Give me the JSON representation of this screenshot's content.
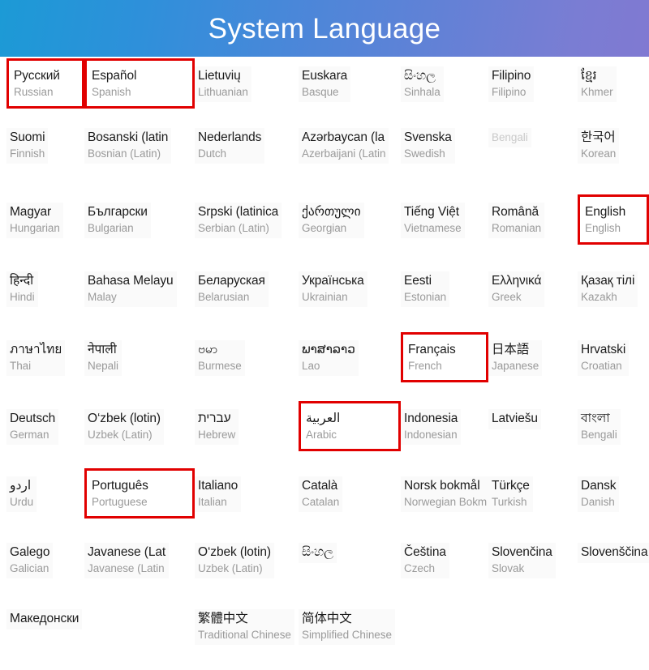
{
  "header": {
    "title": "System Language",
    "gradient_from": "#1C9AD6",
    "gradient_to": "#8079D2",
    "text_color": "#ffffff"
  },
  "highlight": {
    "color": "#e10000",
    "border_px": 3,
    "selected_languages": [
      "Russian",
      "Spanish",
      "English",
      "French",
      "Arabic",
      "Portuguese"
    ]
  },
  "grid": {
    "columns": 7,
    "rows": 9,
    "native_color": "#1b1b1b",
    "english_color": "#9a9a9a",
    "cell_background": "#fafafa"
  },
  "languages": [
    [
      {
        "native": "Русский",
        "english": "Russian",
        "highlighted": true,
        "native_faded": false,
        "english_faded": false
      },
      {
        "native": "Español",
        "english": "Spanish",
        "highlighted": true,
        "native_faded": false,
        "english_faded": false
      },
      {
        "native": "Lietuvių",
        "english": "Lithuanian",
        "highlighted": false,
        "native_faded": false,
        "english_faded": false
      },
      {
        "native": "Euskara",
        "english": "Basque",
        "highlighted": false,
        "native_faded": false,
        "english_faded": false
      },
      {
        "native": "සිංහල",
        "english": "Sinhala",
        "highlighted": false,
        "native_faded": false,
        "english_faded": false
      },
      {
        "native": "Filipino",
        "english": "Filipino",
        "highlighted": false,
        "native_faded": false,
        "english_faded": false
      },
      {
        "native": "ខ្មែរ",
        "english": "Khmer",
        "highlighted": false,
        "native_faded": false,
        "english_faded": false
      }
    ],
    [
      {
        "native": "Suomi",
        "english": "Finnish",
        "highlighted": false,
        "native_faded": false,
        "english_faded": false
      },
      {
        "native": "Bosanski (latin",
        "english": "Bosnian (Latin)",
        "highlighted": false,
        "native_faded": false,
        "english_faded": false
      },
      {
        "native": "Nederlands",
        "english": "Dutch",
        "highlighted": false,
        "native_faded": false,
        "english_faded": false
      },
      {
        "native": "Azərbaycan (la",
        "english": "Azerbaijani (Latin",
        "highlighted": false,
        "native_faded": false,
        "english_faded": false
      },
      {
        "native": "Svenska",
        "english": "Swedish",
        "highlighted": false,
        "native_faded": false,
        "english_faded": false
      },
      {
        "native": "",
        "english": "Bengali",
        "highlighted": false,
        "native_faded": false,
        "english_faded": true
      },
      {
        "native": "한국어",
        "english": "Korean",
        "highlighted": false,
        "native_faded": false,
        "english_faded": false
      }
    ],
    [
      {
        "native": "Magyar",
        "english": "Hungarian",
        "highlighted": false,
        "native_faded": false,
        "english_faded": false
      },
      {
        "native": "Български",
        "english": "Bulgarian",
        "highlighted": false,
        "native_faded": false,
        "english_faded": false
      },
      {
        "native": "Srpski (latinica",
        "english": "Serbian (Latin)",
        "highlighted": false,
        "native_faded": false,
        "english_faded": false
      },
      {
        "native": "ქართული",
        "english": "Georgian",
        "highlighted": false,
        "native_faded": false,
        "english_faded": false
      },
      {
        "native": "Tiếng Việt",
        "english": "Vietnamese",
        "highlighted": false,
        "native_faded": false,
        "english_faded": false
      },
      {
        "native": "Română",
        "english": "Romanian",
        "highlighted": false,
        "native_faded": false,
        "english_faded": false
      },
      {
        "native": "English",
        "english": "English",
        "highlighted": true,
        "native_faded": false,
        "english_faded": false
      }
    ],
    [
      {
        "native": "हिन्दी",
        "english": "Hindi",
        "highlighted": false,
        "native_faded": false,
        "english_faded": false
      },
      {
        "native": "Bahasa Melayu",
        "english": "Malay",
        "highlighted": false,
        "native_faded": false,
        "english_faded": false
      },
      {
        "native": "Беларуская",
        "english": "Belarusian",
        "highlighted": false,
        "native_faded": false,
        "english_faded": false
      },
      {
        "native": "Українська",
        "english": "Ukrainian",
        "highlighted": false,
        "native_faded": false,
        "english_faded": false
      },
      {
        "native": "Eesti",
        "english": "Estonian",
        "highlighted": false,
        "native_faded": false,
        "english_faded": false
      },
      {
        "native": "Ελληνικά",
        "english": "Greek",
        "highlighted": false,
        "native_faded": false,
        "english_faded": false
      },
      {
        "native": "Қазақ тілі",
        "english": "Kazakh",
        "highlighted": false,
        "native_faded": false,
        "english_faded": false
      }
    ],
    [
      {
        "native": "ภาษาไทย",
        "english": "Thai",
        "highlighted": false,
        "native_faded": false,
        "english_faded": false
      },
      {
        "native": "नेपाली",
        "english": "Nepali",
        "highlighted": false,
        "native_faded": false,
        "english_faded": false
      },
      {
        "native": "ဗမာ",
        "english": "Burmese",
        "highlighted": false,
        "native_faded": false,
        "english_faded": false
      },
      {
        "native": "ພາສາລາວ",
        "english": "Lao",
        "highlighted": false,
        "native_faded": false,
        "english_faded": false
      },
      {
        "native": "Français",
        "english": "French",
        "highlighted": true,
        "native_faded": false,
        "english_faded": false
      },
      {
        "native": "日本語",
        "english": "Japanese",
        "highlighted": false,
        "native_faded": false,
        "english_faded": false
      },
      {
        "native": "Hrvatski",
        "english": "Croatian",
        "highlighted": false,
        "native_faded": false,
        "english_faded": false
      }
    ],
    [
      {
        "native": "Deutsch",
        "english": "German",
        "highlighted": false,
        "native_faded": false,
        "english_faded": false
      },
      {
        "native": "O‘zbek (lotin)",
        "english": "Uzbek (Latin)",
        "highlighted": false,
        "native_faded": false,
        "english_faded": false
      },
      {
        "native": "עברית",
        "english": "Hebrew",
        "highlighted": false,
        "native_faded": false,
        "english_faded": false
      },
      {
        "native": "العربية",
        "english": "Arabic",
        "highlighted": true,
        "native_faded": false,
        "english_faded": false
      },
      {
        "native": "Indonesia",
        "english": "Indonesian",
        "highlighted": false,
        "native_faded": false,
        "english_faded": false
      },
      {
        "native": "Latviešu",
        "english": "",
        "highlighted": false,
        "native_faded": false,
        "english_faded": false
      },
      {
        "native": "বাংলা",
        "english": "Bengali",
        "highlighted": false,
        "native_faded": false,
        "english_faded": false
      }
    ],
    [
      {
        "native": "اردو",
        "english": "Urdu",
        "highlighted": false,
        "native_faded": false,
        "english_faded": false
      },
      {
        "native": "Português",
        "english": "Portuguese",
        "highlighted": true,
        "native_faded": false,
        "english_faded": false
      },
      {
        "native": "Italiano",
        "english": "Italian",
        "highlighted": false,
        "native_faded": false,
        "english_faded": false
      },
      {
        "native": "Català",
        "english": "Catalan",
        "highlighted": false,
        "native_faded": false,
        "english_faded": false
      },
      {
        "native": "Norsk bokmål",
        "english": "Norwegian Bokm",
        "highlighted": false,
        "native_faded": false,
        "english_faded": false
      },
      {
        "native": "Türkçe",
        "english": "Turkish",
        "highlighted": false,
        "native_faded": false,
        "english_faded": false
      },
      {
        "native": "Dansk",
        "english": "Danish",
        "highlighted": false,
        "native_faded": false,
        "english_faded": false
      }
    ],
    [
      {
        "native": "Galego",
        "english": "Galician",
        "highlighted": false,
        "native_faded": false,
        "english_faded": false
      },
      {
        "native": "Javanese (Lat",
        "english": "Javanese (Latin",
        "highlighted": false,
        "native_faded": false,
        "english_faded": false
      },
      {
        "native": "O‘zbek (lotin)",
        "english": "Uzbek (Latin)",
        "highlighted": false,
        "native_faded": false,
        "english_faded": false
      },
      {
        "native": "සිංහල",
        "english": "",
        "highlighted": false,
        "native_faded": false,
        "english_faded": false
      },
      {
        "native": "Čeština",
        "english": "Czech",
        "highlighted": false,
        "native_faded": false,
        "english_faded": false
      },
      {
        "native": "Slovenčina",
        "english": "Slovak",
        "highlighted": false,
        "native_faded": false,
        "english_faded": false
      },
      {
        "native": "Slovenščina",
        "english": "",
        "highlighted": false,
        "native_faded": false,
        "english_faded": false
      }
    ],
    [
      {
        "native": "Македонски",
        "english": "",
        "highlighted": false,
        "native_faded": false,
        "english_faded": false
      },
      {
        "native": "",
        "english": "",
        "highlighted": false,
        "native_faded": false,
        "english_faded": false
      },
      {
        "native": "繁體中文",
        "english": "Traditional Chinese",
        "highlighted": false,
        "native_faded": false,
        "english_faded": false
      },
      {
        "native": "简体中文",
        "english": "Simplified Chinese",
        "highlighted": false,
        "native_faded": false,
        "english_faded": false
      },
      {
        "native": "",
        "english": "",
        "highlighted": false,
        "native_faded": false,
        "english_faded": false
      },
      {
        "native": "",
        "english": "",
        "highlighted": false,
        "native_faded": false,
        "english_faded": false
      },
      {
        "native": "",
        "english": "",
        "highlighted": false,
        "native_faded": false,
        "english_faded": false
      }
    ]
  ]
}
